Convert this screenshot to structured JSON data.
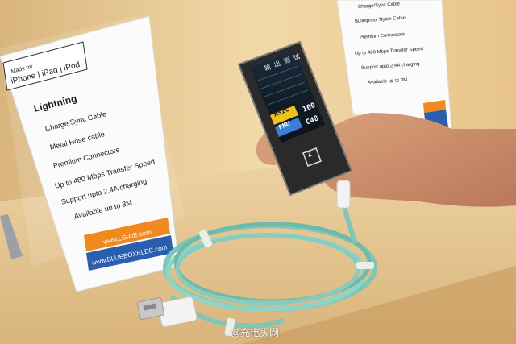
{
  "sign_left": {
    "badge_made_for": "Made for",
    "badge_devices": "iPhone | iPad | iPod",
    "title": "Lightning",
    "features": [
      "Charge/Sync Cable",
      "Metal Hose cable",
      "Premium Connectors",
      "Up to 480 Mbps Transfer Speed",
      "Support upto 2.4A charging",
      "Available up to 3M"
    ],
    "url_1": "www.LG-DE.com",
    "url_2": "www.BLUEBOXELEC.com"
  },
  "sign_right": {
    "lines": [
      "Charge/Sync Cable",
      "Bulletproof Nylon Cable",
      "Premium Connectors",
      "Up to 480 Mbps Transfer Speed",
      "Support upto 2.4A charging",
      "Available up to 3M"
    ]
  },
  "device": {
    "header": "输 出 测 试",
    "asic_label": "ASIC",
    "asic_value": "100",
    "pmu_label": "PMU",
    "pmu_value": "C48",
    "brand_mark": "Z"
  },
  "watermark": "@充电头网",
  "colors": {
    "wall": "#e8c48a",
    "shelf": "#e6c690",
    "cable": "#7ec7b8",
    "device_body": "#2a2a2a",
    "screen_bg": "#101822",
    "asic_yellow": "#f2c21a",
    "pmu_blue": "#3a7fd6",
    "sign_orange": "#f08a1e",
    "sign_blue": "#2a5fb0"
  }
}
